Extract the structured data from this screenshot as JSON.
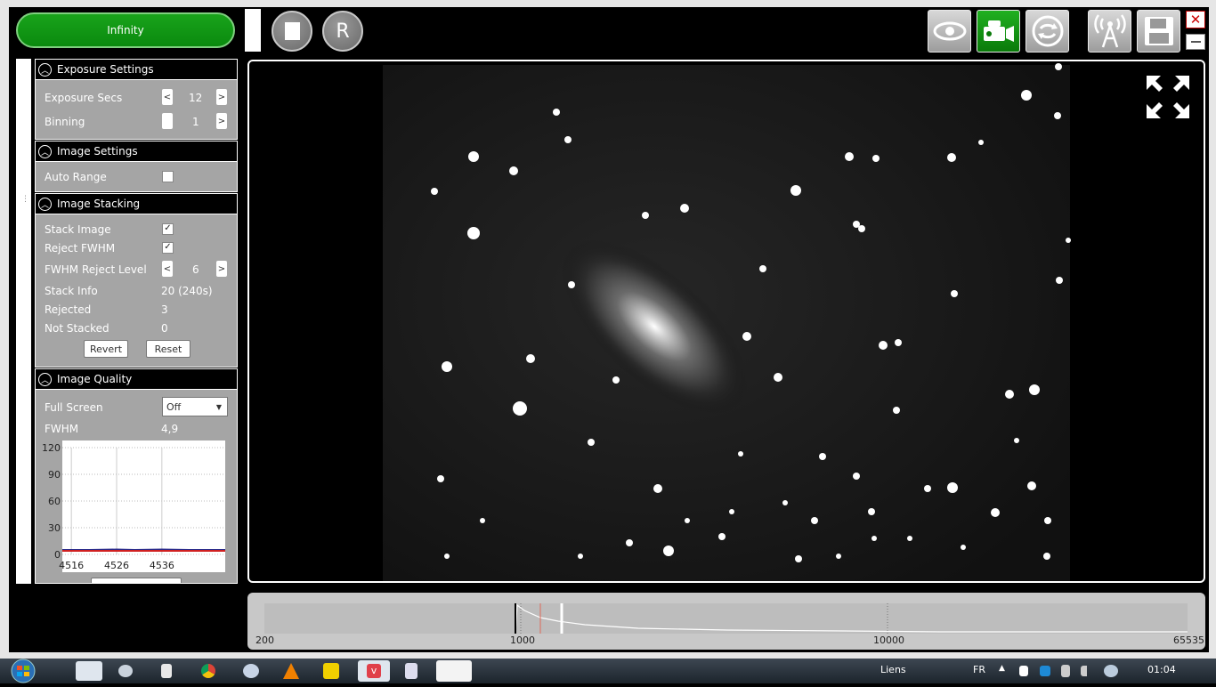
{
  "toolbar": {
    "infinity_label": "Infinity",
    "r_label": "R",
    "close_label": "✕"
  },
  "exposure": {
    "title": "Exposure Settings",
    "exposure_label": "Exposure Secs",
    "exposure_value": "12",
    "binning_label": "Binning",
    "binning_value": "1",
    "dec": "<",
    "inc": ">"
  },
  "image_settings": {
    "title": "Image Settings",
    "auto_range_label": "Auto Range",
    "auto_range_checked": false
  },
  "stacking": {
    "title": "Image Stacking",
    "stack_image_label": "Stack Image",
    "stack_image_check": "✓",
    "reject_fwhm_label": "Reject FWHM",
    "reject_fwhm_check": "✓",
    "fwhm_level_label": "FWHM Reject Level",
    "fwhm_level_value": "6",
    "stack_info_label": "Stack Info",
    "stack_info_value": "20 (240s)",
    "rejected_label": "Rejected",
    "rejected_value": "3",
    "not_stacked_label": "Not Stacked",
    "not_stacked_value": "0",
    "revert_label": "Revert",
    "reset_label": "Reset"
  },
  "quality": {
    "title": "Image Quality",
    "full_screen_label": "Full Screen",
    "full_screen_value": "Off",
    "fwhm_label": "FWHM",
    "fwhm_value": "4,9"
  },
  "chart_data": {
    "type": "line",
    "title": "",
    "yticks": [
      "120",
      "90",
      "60",
      "30",
      "0"
    ],
    "xticks": [
      "4516",
      "4526",
      "4536"
    ],
    "ylim": [
      0,
      120
    ],
    "xlim": [
      4514,
      4550
    ],
    "series": [
      {
        "color": "#2a2a8a",
        "x": [
          4514,
          4520,
          4526,
          4530,
          4536,
          4542,
          4550
        ],
        "y": [
          5,
          5,
          5.5,
          5,
          5.5,
          5,
          5
        ]
      },
      {
        "color": "#d02020",
        "x": [
          4514,
          4550
        ],
        "y": [
          4,
          4
        ]
      }
    ]
  },
  "histogram": {
    "ticks": [
      "200",
      "1000",
      "10000",
      "65535"
    ]
  },
  "taskbar": {
    "liens": "Liens",
    "lang": "FR",
    "time": "01:04"
  }
}
